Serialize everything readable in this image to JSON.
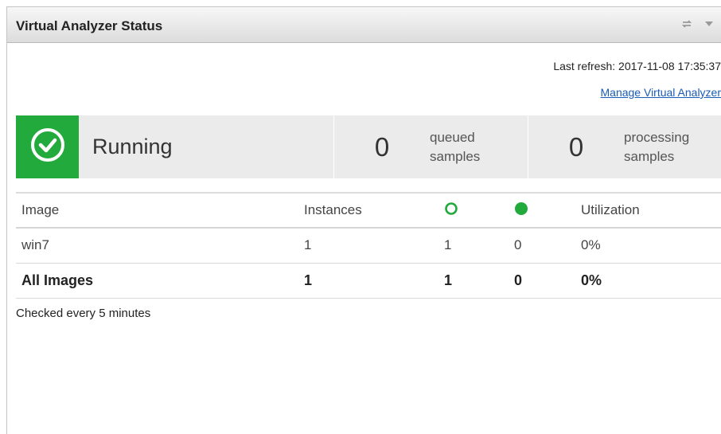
{
  "widget": {
    "title": "Virtual Analyzer Status",
    "last_refresh": "Last refresh: 2017-11-08 17:35:37",
    "manage_link": "Manage Virtual Analyzer"
  },
  "status": {
    "icon": "check-circle-icon",
    "color": "#22aa3c",
    "text": "Running",
    "queued": {
      "count": "0",
      "label_line1": "queued",
      "label_line2": "samples"
    },
    "processing": {
      "count": "0",
      "label_line1": "processing",
      "label_line2": "samples"
    }
  },
  "table": {
    "headers": {
      "image": "Image",
      "instances": "Instances",
      "idle_icon": "hollow-green-circle-icon",
      "busy_icon": "solid-green-circle-icon",
      "utilization": "Utilization"
    },
    "rows": [
      {
        "image": "win7",
        "instances": "1",
        "idle": "1",
        "busy": "0",
        "utilization": "0%"
      }
    ],
    "total": {
      "image": "All Images",
      "instances": "1",
      "idle": "1",
      "busy": "0",
      "utilization": "0%"
    }
  },
  "footer": {
    "checked": "Checked every 5 minutes"
  }
}
